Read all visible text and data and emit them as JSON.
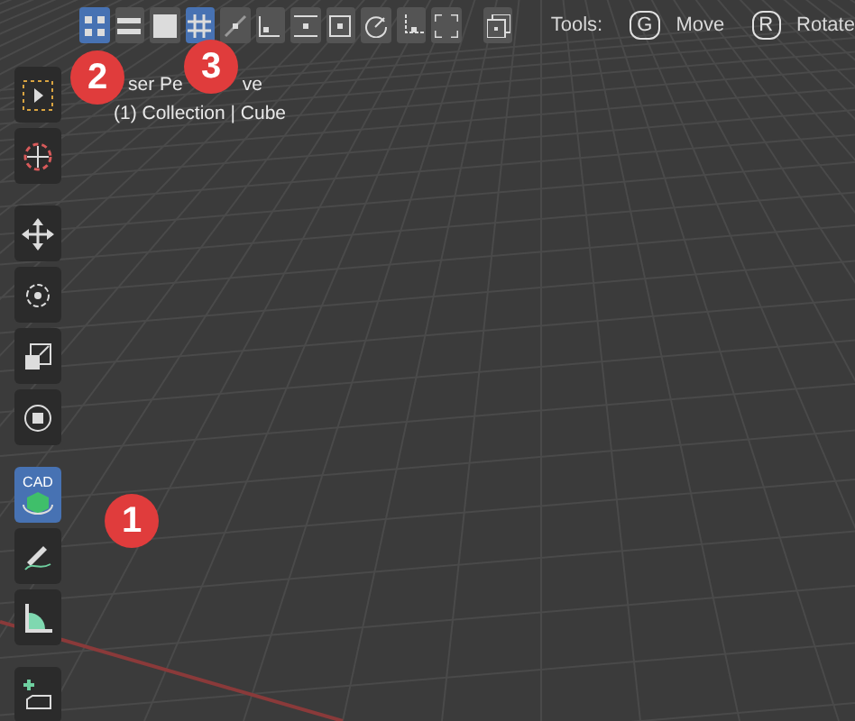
{
  "header_toolbar": [
    {
      "kind": "quad",
      "selected": true
    },
    {
      "kind": "bars",
      "selected": false
    },
    {
      "kind": "fill",
      "selected": false
    },
    {
      "kind": "grid",
      "selected": true
    },
    {
      "kind": "edge",
      "selected": false
    },
    {
      "kind": "corner",
      "selected": false
    },
    {
      "kind": "middle",
      "selected": false
    },
    {
      "kind": "center",
      "selected": false
    },
    {
      "kind": "arc",
      "selected": false
    },
    {
      "kind": "axes",
      "selected": false
    },
    {
      "kind": "frame",
      "selected": false
    },
    {
      "kind": "overlay",
      "selected": false
    }
  ],
  "tools_hint": {
    "label": "Tools:",
    "shortcuts": [
      {
        "key": "G",
        "action": "Move"
      },
      {
        "key": "R",
        "action": "Rotate"
      }
    ]
  },
  "viewport": {
    "view_name_parts": [
      "ser Pe",
      "ve"
    ],
    "collection": "(1) Collection | Cube"
  },
  "left_toolbar": [
    {
      "kind": "select",
      "selected": false
    },
    {
      "kind": "cursor",
      "selected": false
    },
    {
      "kind": "move",
      "selected": false
    },
    {
      "kind": "rotate",
      "selected": false
    },
    {
      "kind": "scale",
      "selected": false
    },
    {
      "kind": "transform",
      "selected": false
    },
    {
      "kind": "cad",
      "label": "CAD",
      "selected": true
    },
    {
      "kind": "annotate",
      "selected": false
    },
    {
      "kind": "measure",
      "selected": false
    },
    {
      "kind": "add",
      "selected": false
    }
  ],
  "callouts": [
    "1",
    "2",
    "3"
  ]
}
